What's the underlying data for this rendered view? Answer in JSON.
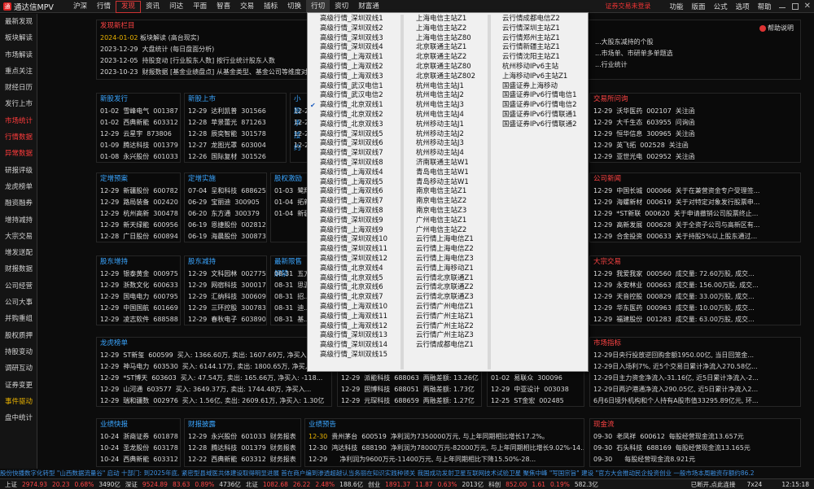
{
  "app": {
    "title": "通达信MPV"
  },
  "menu": [
    "沪深",
    "行情",
    "发现",
    "资讯",
    "问达",
    "平面",
    "智喜",
    "交易",
    "插标",
    "切换",
    "行切",
    "资切",
    "财富通"
  ],
  "topright": {
    "login": "证券交易未登录",
    "items": [
      "功能",
      "版面",
      "公式",
      "选项",
      "帮助"
    ]
  },
  "sidebar": [
    "最新发现",
    "板块解读",
    "市场解读",
    "重点关注",
    "财经日历",
    "发行上市",
    "市场统计",
    "行情数据",
    "异常数据",
    "研报评级",
    "龙虎榜单",
    "融资融券",
    "增持减持",
    "大宗交易",
    "增发送配",
    "财报数据",
    "公司经营",
    "公司大事",
    "并购重组",
    "股权质押",
    "持股变动",
    "调研互动",
    "证券变更",
    "事件驱动",
    "盘中统计"
  ],
  "discover": {
    "title": "发现新栏目",
    "help": "帮助说明",
    "items": [
      {
        "date": "2024-01-02",
        "text": "板块解读 (高台现实)"
      },
      {
        "date": "2023-12-29",
        "text": "大盘统计 (每日盘面分析)"
      },
      {
        "date": "2023-12-05",
        "text": "持股变动 [行业股东人数] 按行业统计股东人数"
      },
      {
        "date": "2023-10-23",
        "text": "财报数据 [基金业绩盘点] 从基金类型、基金公司等维度对基金..."
      }
    ],
    "right_lines": [
      "...大股东减持的个股",
      "...市场单、市研单多单题选",
      "...行业统计"
    ]
  },
  "xgss": {
    "title": "新股发行",
    "rows": [
      [
        "01-02",
        "雪峰电气",
        "001387"
      ],
      [
        "01-02",
        "西典新能",
        "603312"
      ],
      [
        "12-29",
        "云星宇",
        "873806"
      ],
      [
        "01-09",
        "腾达科技",
        "001379"
      ],
      [
        "01-08",
        "永兴股份",
        "601033"
      ]
    ]
  },
  "xssh": {
    "title": "新股上市",
    "rows": [
      [
        "12-29",
        "达利凯普",
        "301566"
      ],
      [
        "12-28",
        "苹景蕾光",
        "871263"
      ],
      [
        "12-28",
        "辰奕智能",
        "301578"
      ],
      [
        "12-27",
        "龙图光罩",
        "603004"
      ],
      [
        "12-26",
        "国际复材",
        "301526"
      ]
    ]
  },
  "xgzf": {
    "title": "小股承接约",
    "rows": [
      [
        "12-29",
        "飘..."
      ],
      [
        "12-29",
        "*ST..."
      ],
      [
        "12-29",
        "*ST..."
      ],
      [
        "12-29",
        "*ST..."
      ]
    ]
  },
  "dzyy": {
    "title": "交易所问询",
    "rows": [
      [
        "12-29",
        "沃华医药",
        "002107",
        "关注函"
      ],
      [
        "12-29",
        "大千生态",
        "603955",
        "问询函"
      ],
      [
        "12-29",
        "恒华信息",
        "300965",
        "关注函"
      ],
      [
        "12-29",
        "英飞拓",
        "002528",
        "关注函"
      ],
      [
        "12-29",
        "亚世光电",
        "002952",
        "关注函"
      ]
    ],
    "partial": [
      "2227",
      "0508",
      "2383",
      "1808",
      "0541"
    ]
  },
  "dzya": {
    "title": "定增预案",
    "rows": [
      [
        "12-29",
        "新疆股份",
        "600782"
      ],
      [
        "12-29",
        "路局装备",
        "002420"
      ],
      [
        "12-29",
        "杭州高新",
        "300478"
      ],
      [
        "12-29",
        "新天绿能",
        "600956"
      ],
      [
        "12-28",
        "广日股份",
        "600894"
      ]
    ]
  },
  "dzss": {
    "title": "定增实施",
    "rows": [
      [
        "07-04",
        "呈和科技",
        "688625"
      ],
      [
        "06-29",
        "宝丽迪",
        "300905"
      ],
      [
        "06-20",
        "东方通",
        "300379"
      ],
      [
        "06-19",
        "恩捷股份",
        "002812"
      ],
      [
        "06-19",
        "海晨股份",
        "300873"
      ]
    ]
  },
  "gqjl": {
    "title": "股权激励",
    "rows": [
      [
        "01-03",
        "鹭翔..."
      ],
      [
        "01-04",
        "拓新..."
      ],
      [
        "01-04",
        "新疆..."
      ]
    ]
  },
  "gsxw": {
    "title": "公司新闻",
    "rows": [
      [
        "12-29",
        "中国长城",
        "000066",
        "关于在兼营资金专户受理签..."
      ],
      [
        "12-29",
        "海螺新材",
        "000619",
        "关于对特定对象发行股票申..."
      ],
      [
        "12-29",
        "*ST新联",
        "000620",
        "关于申请撤销公司股票终止..."
      ],
      [
        "12-29",
        "高新发展",
        "000628",
        "关于全资子公司与高新区有..."
      ],
      [
        "12-29",
        "合金投资",
        "000633",
        "关于持股5%以上股东通过..."
      ]
    ]
  },
  "gdzc": {
    "title": "股东增持",
    "rows": [
      [
        "12-29",
        "银泰黄金",
        "000975"
      ],
      [
        "12-29",
        "浙数文化",
        "600633"
      ],
      [
        "12-29",
        "国电电力",
        "600795"
      ],
      [
        "12-29",
        "中国国航",
        "601669"
      ],
      [
        "12-29",
        "凌志软件",
        "688588"
      ]
    ]
  },
  "gdjc": {
    "title": "股东减持",
    "rows": [
      [
        "12-29",
        "文科园林",
        "002775"
      ],
      [
        "12-29",
        "网宿科技",
        "300017"
      ],
      [
        "12-29",
        "汇纳科技",
        "300609"
      ],
      [
        "12-29",
        "三环控股",
        "300783"
      ],
      [
        "12-29",
        "春秋电子",
        "603890"
      ]
    ]
  },
  "zxlt": {
    "title": "最新限售解禁",
    "rows": [
      [
        "08-31",
        "五方..."
      ],
      [
        "08-31",
        "思源..."
      ],
      [
        "08-31",
        "招..."
      ],
      [
        "08-31",
        "迪..."
      ],
      [
        "08-31",
        "基..."
      ]
    ]
  },
  "dzjy": {
    "title": "大宗交易",
    "rows": [
      [
        "12-29",
        "我爱我家",
        "000560",
        "成交量: 72.60万股, 成交..."
      ],
      [
        "12-29",
        "永安林业",
        "000663",
        "成交量: 156.00万股, 成交..."
      ],
      [
        "12-29",
        "天音控股",
        "000829",
        "成交量: 33.00万股, 成交..."
      ],
      [
        "12-29",
        "华东医药",
        "000963",
        "成交量: 10.00万股, 成交..."
      ],
      [
        "12-29",
        "福建股份",
        "001283",
        "成交量: 63.00万股, 成交..."
      ]
    ]
  },
  "lhbd": {
    "title": "龙虎榜单",
    "rows": [
      [
        "12-29",
        "ST新玺",
        "600599",
        "买入: 1366.60万, 卖出: 1607.69万, 净买入..."
      ],
      [
        "12-29",
        "神马电力",
        "603530",
        "买入: 6144.17万, 卖出: 1800.65万, 净买入..."
      ],
      [
        "12-29",
        "*ST博天",
        "603603",
        "买入: 47.54万, 卖出: 165.66万, 净买入: -118..."
      ],
      [
        "12-29",
        "山河通",
        "603577",
        "买入: 3649.37万, 卖出: 1744.48万, 净买入..."
      ],
      [
        "12-29",
        "瑞和疆数",
        "002976",
        "买入: 1.56亿, 卖出: 2609.61万, 净买入: 1.30亿"
      ]
    ]
  },
  "rzrq": {
    "rows": [
      [
        "12-29",
        "派能科技",
        "688063",
        "两融差额: 13.26亿"
      ],
      [
        "12-29",
        "固博科技",
        "688051",
        "两融差额: 1.73亿"
      ],
      [
        "12-29",
        "元琛科技",
        "688659",
        "两融差额: 1.27亿"
      ]
    ]
  },
  "zqbg": {
    "rows": [
      [
        "01-02",
        "易联众",
        "300096"
      ],
      [
        "12-29",
        "中亚设计",
        "003038"
      ],
      [
        "12-25",
        "ST金宏",
        "002485"
      ]
    ]
  },
  "sczb": {
    "title": "市场指标",
    "rows": [
      "12-29日央行投放逆回购金额1950.00亿, 当日回笼金...",
      "12-29日入场利7%, 近5个交易日累计净流入270.58亿...",
      "12-29日主力资金净流入-31.16亿, 近5日累计净流入-2...",
      "12-29日两沪港通净流入290.05亿, 近5日累计净流入2...",
      "6月6日境外机构和个人持有A股市值33295.89亿元, 环..."
    ]
  },
  "yjkb": {
    "title": "业绩快报",
    "rows": [
      [
        "10-24",
        "浙商证券",
        "601878"
      ],
      [
        "10-24",
        "圣龙股份",
        "603178"
      ],
      [
        "10-24",
        "西典新能",
        "603312"
      ],
      [
        "10-20",
        "通伟能源",
        "600519"
      ]
    ]
  },
  "cbjl": {
    "title": "财报披露",
    "rows": [
      [
        "12-29",
        "永兴股份",
        "601033",
        "财务报表"
      ],
      [
        "12-28",
        "腾达科技",
        "001379",
        "财务报表"
      ],
      [
        "12-22",
        "西典新能",
        "603312",
        "财务报表"
      ],
      [
        "12-14",
        "...",
        "",
        "财务报表"
      ]
    ]
  },
  "yjyg": {
    "title": "业绩预告",
    "rows": [
      [
        "12-30",
        "贵州茅台",
        "600519",
        "净利润为7350000万元, 与上年同期相比增长17.2%。"
      ],
      [
        "12-30",
        "鸿达科技",
        "688190",
        "净利润为78000万元-82000万元, 与上年同期相比增长9.02%-14..."
      ],
      [
        "12-29",
        "",
        "",
        "净利润为9600万元-11400万元, 与上年同期相比下降15.50%-28..."
      ],
      [
        "12-29",
        "",
        "",
        "..."
      ]
    ]
  },
  "xjf": {
    "title": "现金流",
    "rows": [
      [
        "09-30",
        "老凤祥",
        "600612",
        "每股经营现金流13.657元"
      ],
      [
        "09-30",
        "石头科技",
        "688169",
        "每股经营现金流13.165元"
      ],
      [
        "09-30",
        "",
        "",
        "每股经营现金流8.921元"
      ]
    ]
  },
  "dropdown": {
    "col1": [
      "高级行情_深圳双线1",
      "高级行情_深圳双线2",
      "高级行情_深圳双线3",
      "高级行情_深圳双线4",
      "高级行情_上海双线1",
      "高级行情_上海双线2",
      "高级行情_上海双线3",
      "高级行情_武汉电信1",
      "高级行情_武汉电信2",
      "高级行情_北京双线1",
      "高级行情_北京双线2",
      "高级行情_北京双线3",
      "高级行情_深圳双线5",
      "高级行情_深圳双线6",
      "高级行情_深圳双线7",
      "高级行情_深圳双线8",
      "高级行情_上海双线4",
      "高级行情_上海双线5",
      "高级行情_上海双线6",
      "高级行情_上海双线7",
      "高级行情_上海双线8",
      "高级行情_深圳双线9",
      "高级行情_上海双线9",
      "高级行情_深圳双线10",
      "高级行情_深圳双线11",
      "高级行情_深圳双线12",
      "高级行情_北京双线4",
      "高级行情_北京双线5",
      "高级行情_北京双线6",
      "高级行情_北京双线7",
      "高级行情_上海双线10",
      "高级行情_上海双线11",
      "高级行情_上海双线12",
      "高级行情_深圳双线13",
      "高级行情_深圳双线14",
      "高级行情_深圳双线15"
    ],
    "checked_index": 9,
    "col2": [
      "上海电信主站Z1",
      "上海电信主站Z2",
      "上海电信主站Z80",
      "北京联通主站Z1",
      "北京联通主站Z2",
      "北京联通主站Z80",
      "北京联通主站Z802",
      "杭州电信主站J1",
      "杭州电信主站J2",
      "杭州电信主站J3",
      "杭州电信主站J4",
      "杭州移动主站J1",
      "杭州移动主站J2",
      "杭州移动主站J3",
      "杭州移动主站J4",
      "济南联通主站W1",
      "青岛电信主站W1",
      "青岛移动主站W1",
      "南京电信主站Z1",
      "南京电信主站Z2",
      "南京电信主站Z3",
      "广州电信主站Z1",
      "广州电信主站Z2",
      "云行情上海电信Z1",
      "云行情上海电信Z2",
      "云行情上海电信Z3",
      "云行情上海移动Z1",
      "云行情北京联通Z1",
      "云行情北京联通Z2",
      "云行情北京联通Z3",
      "云行情广州电信Z1",
      "云行情广州主站Z1",
      "云行情广州主站Z2",
      "云行情广州主站Z3",
      "云行情成都电信Z1"
    ],
    "col3": [
      "云行情成都电信Z2",
      "云行情深圳主站Z1",
      "云行情郑州主站Z1",
      "云行情新疆主站Z1",
      "云行情沈阳主站Z1",
      "杭州移动IPv6主站",
      "上海移动IPv6主站Z1",
      "国盛证券上海移动",
      "国盛证券IPv6行情电信1",
      "国盛证券IPv6行情电信2",
      "国盛证券IPv6行情联通1",
      "国盛证券IPv6行情联通2"
    ]
  },
  "ticker": "股份快播数字化转型   \"山西数据流量谷\" 启动        十部门: 到2025年底, 紧密型县域医共体建设取得明显进展        首在商户编到渗透超越认当务丽在知识实践种领关    我国成功发射卫星互联网技术试验卫星    聚焦中峰 \"写国宗旨\" 建设 \"官方大会推动民企投资创业    一般市场本周融资存额约86.2",
  "status": {
    "sh": "上证",
    "sh_v": "2974.93",
    "sh_c": "20.23",
    "sh_p": "0.68%",
    "sh_a": "3490亿",
    "sz": "深证",
    "sz_v": "9524.89",
    "sz_c": "83.63",
    "sz_p": "0.89%",
    "sz_a": "4736亿",
    "cy": "北证",
    "cy_v": "1082.68",
    "cy_c": "26.22",
    "cy_p": "2.48%",
    "cy_a": "188.6亿",
    "kc": "创业",
    "kc_v": "1891.37",
    "kc_c": "11.87",
    "kc_p": "0.63%",
    "kc_a": "2013亿",
    "kc2": "科创",
    "kc2_v": "852.00",
    "kc2_c": "1.61",
    "kc2_p": "0.19%",
    "kc2_a": "582.3亿",
    "link": "已断开,点此连接",
    "time": "12:15:18",
    "ver": "7x24"
  }
}
